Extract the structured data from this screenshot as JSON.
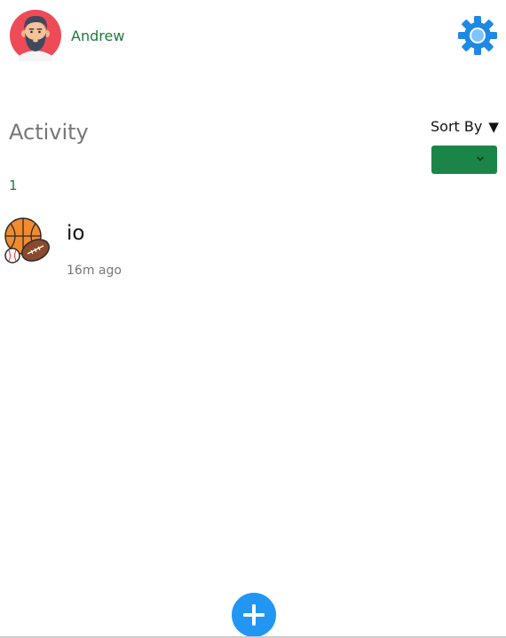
{
  "header": {
    "user_name": "Andrew",
    "avatar_icon": "bearded-man-avatar",
    "settings_icon": "gear-icon",
    "settings_color": "#1e88e5"
  },
  "activity": {
    "title": "Activity",
    "sort_label": "Sort By",
    "sort_icon": "triangle-down",
    "sort_selected": "",
    "count": "1",
    "accent": "#1b8548",
    "items": [
      {
        "title": "io",
        "time": "16m ago",
        "icon": "sports-balls-icon"
      }
    ]
  },
  "fab": {
    "icon": "plus-icon",
    "color": "#2196f3"
  }
}
